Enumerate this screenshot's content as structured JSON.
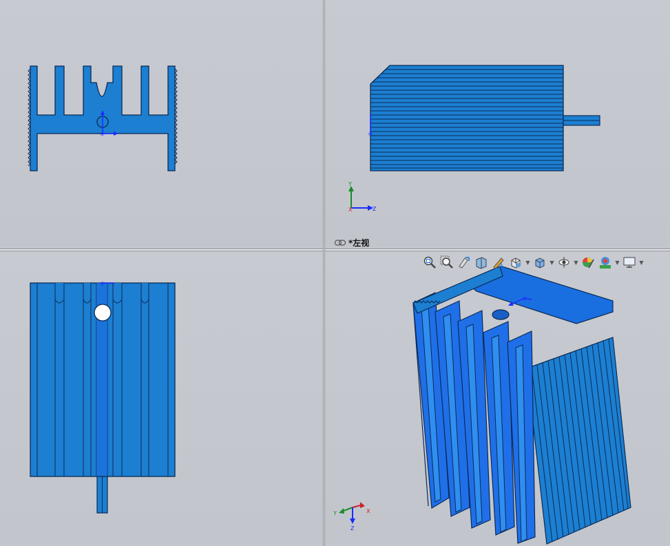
{
  "views": {
    "top_left": {
      "name": ""
    },
    "top_right": {
      "label": "*左视"
    },
    "bottom_left": {
      "name": ""
    },
    "bottom_right": {
      "name": ""
    }
  },
  "axes": {
    "top_right": {
      "x": "X",
      "y": "Y",
      "z": "Z"
    },
    "bottom_right": {
      "x": "X",
      "y": "Y",
      "z": "Z"
    }
  },
  "toolbar": {
    "items": [
      "zoom-to-fit-icon",
      "zoom-to-area-icon",
      "previous-view-icon",
      "section-view-icon",
      "dynamic-annotation-icon",
      "view-orientation-icon",
      "display-style-icon",
      "hide-show-items-icon",
      "edit-appearance-icon",
      "apply-scene-icon",
      "view-settings-icon"
    ]
  },
  "colors": {
    "part_fill": "#1c7fd1",
    "part_edge": "#0b2a55",
    "background": "#c5c8cf",
    "origin_blue": "#1a2bff",
    "axis_red": "#d0202a",
    "axis_green": "#1a8a2a"
  }
}
